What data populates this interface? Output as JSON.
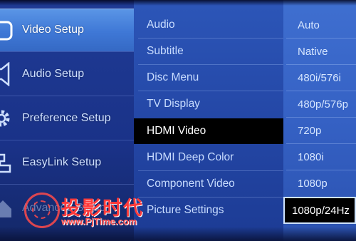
{
  "left_menu": {
    "items": [
      {
        "label": "Video Setup",
        "icon": "video-setup-icon",
        "selected": true
      },
      {
        "label": "Audio Setup",
        "icon": "speaker-icon",
        "selected": false
      },
      {
        "label": "Preference Setup",
        "icon": "gear-icon",
        "selected": false
      },
      {
        "label": "EasyLink Setup",
        "icon": "easylink-icon",
        "selected": false
      },
      {
        "label": "Advanced Setup",
        "icon": "home-icon",
        "selected": false
      }
    ]
  },
  "middle_menu": {
    "items": [
      {
        "label": "Audio"
      },
      {
        "label": "Subtitle"
      },
      {
        "label": "Disc Menu"
      },
      {
        "label": "TV Display"
      },
      {
        "label": "HDMI Video",
        "highlighted": true
      },
      {
        "label": "HDMI Deep Color"
      },
      {
        "label": "Component Video"
      },
      {
        "label": "Picture Settings"
      }
    ]
  },
  "right_menu": {
    "items": [
      {
        "label": "Auto"
      },
      {
        "label": "Native"
      },
      {
        "label": "480i/576i"
      },
      {
        "label": "480p/576p"
      },
      {
        "label": "720p"
      },
      {
        "label": "1080i"
      },
      {
        "label": "1080p"
      },
      {
        "label": "1080p/24Hz",
        "selected": true
      }
    ]
  },
  "watermark": {
    "chinese": "投影时代",
    "url": "www.PjTime.com"
  },
  "colors": {
    "selected_left": "#4a86df",
    "highlight": "#000000",
    "watermark": "#ff3b3b"
  }
}
